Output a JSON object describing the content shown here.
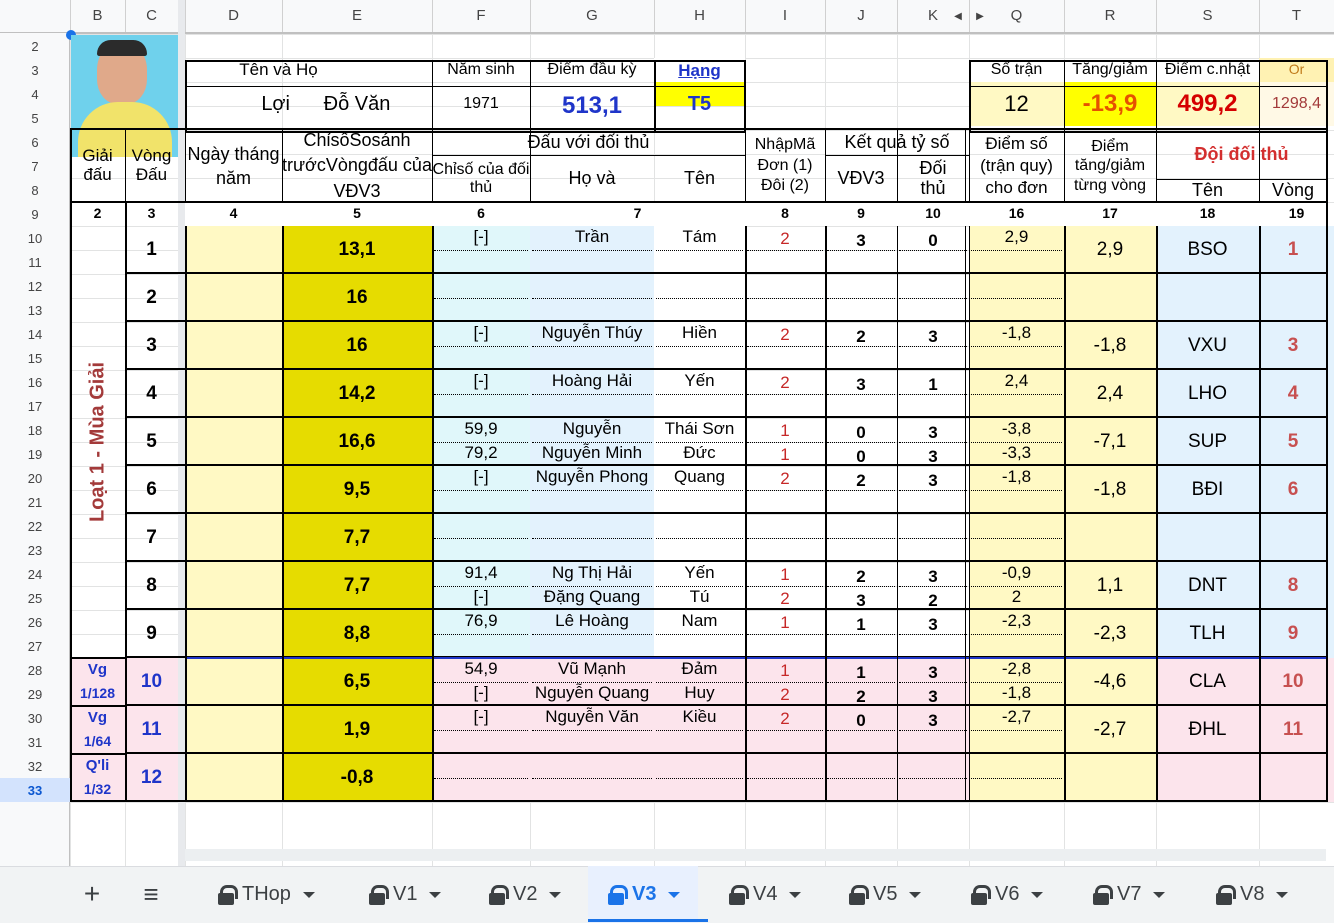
{
  "columns": [
    "B",
    "C",
    "D",
    "E",
    "F",
    "G",
    "H",
    "I",
    "J",
    "K",
    "Q",
    "R",
    "S",
    "T"
  ],
  "row_numbers": [
    "2",
    "3",
    "4",
    "5",
    "6",
    "7",
    "8",
    "9",
    "10",
    "11",
    "12",
    "13",
    "14",
    "15",
    "16",
    "17",
    "18",
    "19",
    "20",
    "21",
    "22",
    "23",
    "24",
    "25",
    "26",
    "27",
    "28",
    "29",
    "30",
    "31",
    "32",
    "33"
  ],
  "player": {
    "label_ten_ho": "Tên     và     Họ",
    "label_nam_sinh": "Năm sinh",
    "label_diem_dau_ky": "Điểm đầu kỳ",
    "label_hang": "Hạng",
    "ten": "Lợi",
    "ho": "Đỗ Văn",
    "nam_sinh": "1971",
    "diem_dau_ky": "513,1",
    "hang": "T5"
  },
  "summary": {
    "label_so_tran": "Số trận",
    "label_tang_giam": "Tăng/giảm",
    "label_diem_cnhat": "Điểm c.nhật",
    "label_or": "Or",
    "so_tran": "12",
    "tang_giam": "-13,9",
    "diem_cnhat": "499,2",
    "or": "1298,4"
  },
  "headers": {
    "giai_dau": "Giải đấu",
    "vong_dau": "Vòng Đấu",
    "ngay": "Ngày tháng năm",
    "chiso": "ChỉsốSosánh trướcVòngđấu của VĐV3",
    "dau_voi": "Đấu với đối thủ",
    "chiso_doithu": "Chỉsố của đối thủ",
    "ho": "Họ     và",
    "ten": "Tên",
    "nhapma": "NhậpMã Đơn (1) Đôi (2)",
    "ketqua": "Kết quả tỷ số",
    "vdv3": "VĐV3",
    "doithu": "Đối thủ",
    "diemso": "Điểm số (trận quy) cho đơn",
    "diem_tang": "Điểm tăng/giảm từng vòng",
    "doi_doithu": "Đội đối thủ",
    "doi_ten": "Tên",
    "doi_vong": "Vòng"
  },
  "col_numbers": [
    "2",
    "3",
    "4",
    "5",
    "6",
    "7",
    "8",
    "9",
    "10",
    "16",
    "17",
    "18",
    "19"
  ],
  "season_label": "Loạt 1 - Mùa Giải",
  "rounds": [
    {
      "vong": "1",
      "chiso": "13,1",
      "diem_tang": "2,9",
      "doi": "BSO",
      "doi_vong": "1",
      "lines": [
        {
          "cs": "[-]",
          "ho": "Trần",
          "ten": "Tám",
          "ma": "2",
          "v": "3",
          "d": "0",
          "ds": "2,9"
        }
      ]
    },
    {
      "vong": "2",
      "chiso": "16",
      "diem_tang": "",
      "doi": "",
      "doi_vong": "",
      "lines": []
    },
    {
      "vong": "3",
      "chiso": "16",
      "diem_tang": "-1,8",
      "doi": "VXU",
      "doi_vong": "3",
      "lines": [
        {
          "cs": "[-]",
          "ho": "Nguyễn Thúy",
          "ten": "Hiền",
          "ma": "2",
          "v": "2",
          "d": "3",
          "ds": "-1,8"
        }
      ]
    },
    {
      "vong": "4",
      "chiso": "14,2",
      "diem_tang": "2,4",
      "doi": "LHO",
      "doi_vong": "4",
      "lines": [
        {
          "cs": "[-]",
          "ho": "Hoàng Hải",
          "ten": "Yến",
          "ma": "2",
          "v": "3",
          "d": "1",
          "ds": "2,4"
        }
      ]
    },
    {
      "vong": "5",
      "chiso": "16,6",
      "diem_tang": "-7,1",
      "doi": "SUP",
      "doi_vong": "5",
      "lines": [
        {
          "cs": "59,9",
          "ho": "Nguyễn",
          "ten": "Thái Sơn",
          "ma": "1",
          "v": "0",
          "d": "3",
          "ds": "-3,8"
        },
        {
          "cs": "79,2",
          "ho": "Nguyễn Minh",
          "ten": "Đức",
          "ma": "1",
          "v": "0",
          "d": "3",
          "ds": "-3,3"
        }
      ]
    },
    {
      "vong": "6",
      "chiso": "9,5",
      "diem_tang": "-1,8",
      "doi": "BĐI",
      "doi_vong": "6",
      "lines": [
        {
          "cs": "[-]",
          "ho": "Nguyễn Phong",
          "ten": "Quang",
          "ma": "2",
          "v": "2",
          "d": "3",
          "ds": "-1,8"
        }
      ]
    },
    {
      "vong": "7",
      "chiso": "7,7",
      "diem_tang": "",
      "doi": "",
      "doi_vong": "",
      "lines": []
    },
    {
      "vong": "8",
      "chiso": "7,7",
      "diem_tang": "1,1",
      "doi": "DNT",
      "doi_vong": "8",
      "lines": [
        {
          "cs": "91,4",
          "ho": "Ng Thị Hải",
          "ten": "Yến",
          "ma": "1",
          "v": "2",
          "d": "3",
          "ds": "-0,9"
        },
        {
          "cs": "[-]",
          "ho": "Đặng Quang",
          "ten": "Tú",
          "ma": "2",
          "v": "3",
          "d": "2",
          "ds": "2"
        }
      ]
    },
    {
      "vong": "9",
      "chiso": "8,8",
      "diem_tang": "-2,3",
      "doi": "TLH",
      "doi_vong": "9",
      "lines": [
        {
          "cs": "76,9",
          "ho": "Lê Hoàng",
          "ten": "Nam",
          "ma": "1",
          "v": "1",
          "d": "3",
          "ds": "-2,3"
        }
      ]
    },
    {
      "vong": "10",
      "chiso": "6,5",
      "diem_tang": "-4,6",
      "doi": "CLA",
      "doi_vong": "10",
      "giai_top": "Vg",
      "giai_bot": "1/128",
      "lines": [
        {
          "cs": "54,9",
          "ho": "Vũ Mạnh",
          "ten": "Đảm",
          "ma": "1",
          "v": "1",
          "d": "3",
          "ds": "-2,8"
        },
        {
          "cs": "[-]",
          "ho": "Nguyễn Quang",
          "ten": "Huy",
          "ma": "2",
          "v": "2",
          "d": "3",
          "ds": "-1,8"
        }
      ]
    },
    {
      "vong": "11",
      "chiso": "1,9",
      "diem_tang": "-2,7",
      "doi": "ĐHL",
      "doi_vong": "11",
      "giai_top": "Vg",
      "giai_bot": "1/64",
      "lines": [
        {
          "cs": "[-]",
          "ho": "Nguyễn Văn",
          "ten": "Kiều",
          "ma": "2",
          "v": "0",
          "d": "3",
          "ds": "-2,7"
        }
      ]
    },
    {
      "vong": "12",
      "chiso": "-0,8",
      "diem_tang": "",
      "doi": "",
      "doi_vong": "",
      "giai_top": "Q'li",
      "giai_bot": "1/32",
      "lines": []
    }
  ],
  "sheet_tabs": [
    {
      "label": "THop",
      "active": false
    },
    {
      "label": "V1",
      "active": false
    },
    {
      "label": "V2",
      "active": false
    },
    {
      "label": "V3",
      "active": true
    },
    {
      "label": "V4",
      "active": false
    },
    {
      "label": "V5",
      "active": false
    },
    {
      "label": "V6",
      "active": false
    },
    {
      "label": "V7",
      "active": false
    },
    {
      "label": "V8",
      "active": false
    }
  ],
  "add_sheet": "+",
  "all_sheets": "≡",
  "colors": {
    "yellow": "#ffff00",
    "olive": "#e6dc00",
    "light_yellow": "#fff9c4",
    "cyan": "#e0f7fa",
    "blue_light": "#e3f2fd",
    "pink": "#fce4ec",
    "active_tab": "#1a73e8"
  }
}
